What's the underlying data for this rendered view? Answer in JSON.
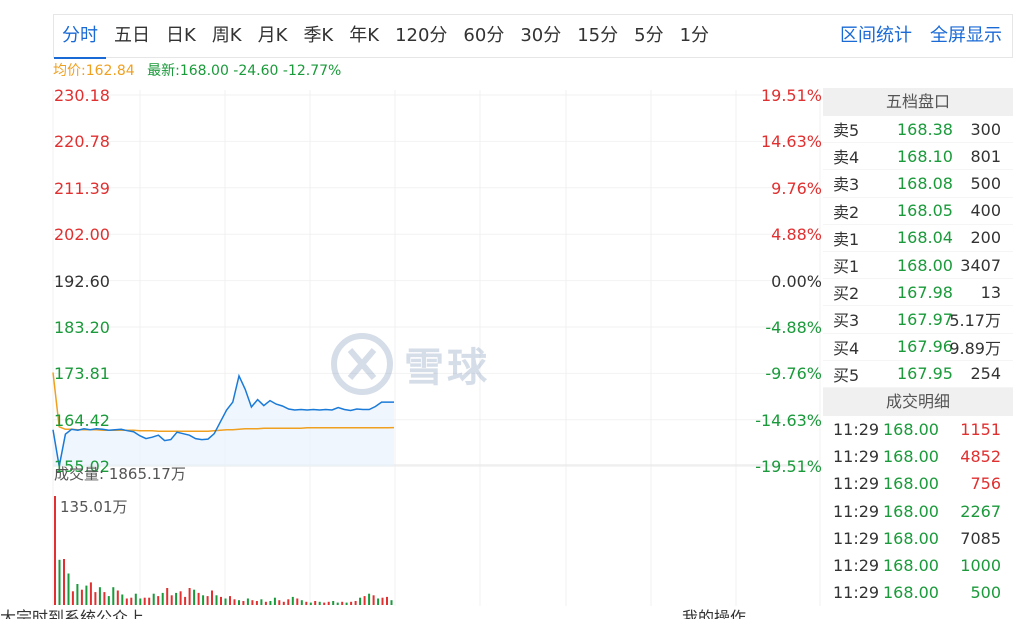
{
  "tabs": [
    "分时",
    "五日",
    "日K",
    "周K",
    "月K",
    "季K",
    "年K",
    "120分",
    "60分",
    "30分",
    "15分",
    "5分",
    "1分"
  ],
  "active_tab": "分时",
  "tabs_right": [
    "区间统计",
    "全屏显示"
  ],
  "info": {
    "avg": "均价:162.84",
    "latest": "最新:168.00 -24.60 -12.77%"
  },
  "y_left": [
    "230.18",
    "220.78",
    "211.39",
    "202.00",
    "192.60",
    "183.20",
    "173.81",
    "164.42",
    "155.02"
  ],
  "y_right": [
    "19.51%",
    "14.63%",
    "9.76%",
    "4.88%",
    "0.00%",
    "-4.88%",
    "-9.76%",
    "-14.63%",
    "-19.51%"
  ],
  "volume_label": "成交量: 1865.17万",
  "volume_max": "135.01万",
  "watermark": "雪球",
  "order_book": {
    "title": "五档盘口",
    "rows": [
      {
        "label": "卖5",
        "price": "168.38",
        "vol": "300"
      },
      {
        "label": "卖4",
        "price": "168.10",
        "vol": "801"
      },
      {
        "label": "卖3",
        "price": "168.08",
        "vol": "500"
      },
      {
        "label": "卖2",
        "price": "168.05",
        "vol": "400"
      },
      {
        "label": "卖1",
        "price": "168.04",
        "vol": "200"
      },
      {
        "label": "买1",
        "price": "168.00",
        "vol": "3407"
      },
      {
        "label": "买2",
        "price": "167.98",
        "vol": "13"
      },
      {
        "label": "买3",
        "price": "167.97",
        "vol": "5.17万"
      },
      {
        "label": "买4",
        "price": "167.96",
        "vol": "9.89万"
      },
      {
        "label": "买5",
        "price": "167.95",
        "vol": "254"
      }
    ]
  },
  "trades": {
    "title": "成交明细",
    "rows": [
      {
        "time": "11:29",
        "price": "168.00",
        "vol": "1151",
        "color": "#e03030"
      },
      {
        "time": "11:29",
        "price": "168.00",
        "vol": "4852",
        "color": "#e03030"
      },
      {
        "time": "11:29",
        "price": "168.00",
        "vol": "756",
        "color": "#e03030"
      },
      {
        "time": "11:29",
        "price": "168.00",
        "vol": "2267",
        "color": "#1a9a3a"
      },
      {
        "time": "11:29",
        "price": "168.00",
        "vol": "7085",
        "color": "#333333"
      },
      {
        "time": "11:29",
        "price": "168.00",
        "vol": "1000",
        "color": "#1a9a3a"
      },
      {
        "time": "11:29",
        "price": "168.00",
        "vol": "500",
        "color": "#1a9a3a"
      }
    ]
  },
  "chart_data": {
    "type": "line",
    "price_series": [
      162.4,
      155.0,
      161.5,
      162.5,
      162.3,
      162.6,
      162.4,
      162.6,
      162.5,
      162.3,
      162.4,
      162.5,
      162.2,
      162.0,
      161.2,
      160.6,
      160.9,
      161.3,
      160.2,
      160.4,
      161.9,
      161.6,
      161.3,
      160.6,
      160.4,
      160.5,
      161.6,
      164.0,
      166.4,
      168.0,
      173.3,
      170.6,
      167.0,
      168.5,
      167.3,
      168.3,
      167.6,
      167.2,
      166.6,
      166.4,
      166.5,
      166.4,
      166.5,
      166.4,
      166.5,
      166.4,
      166.9,
      166.5,
      166.3,
      166.6,
      166.5,
      166.5,
      167.1,
      168.0,
      168.0,
      168.0
    ],
    "avg_series": [
      174.0,
      163.0,
      162.5,
      162.5,
      162.4,
      162.4,
      162.4,
      162.4,
      162.3,
      162.3,
      162.3,
      162.3,
      162.3,
      162.3,
      162.2,
      162.2,
      162.2,
      162.1,
      162.1,
      162.1,
      162.1,
      162.1,
      162.1,
      162.1,
      162.1,
      162.1,
      162.2,
      162.3,
      162.4,
      162.4,
      162.5,
      162.6,
      162.6,
      162.6,
      162.7,
      162.7,
      162.7,
      162.7,
      162.7,
      162.7,
      162.7,
      162.8,
      162.8,
      162.8,
      162.8,
      162.8,
      162.8,
      162.8,
      162.8,
      162.8,
      162.8,
      162.8,
      162.8,
      162.8,
      162.8,
      162.84
    ],
    "volume_series": [
      135.0,
      56.0,
      57.0,
      39.0,
      17.0,
      26.0,
      19.0,
      24.0,
      28.0,
      16.0,
      22.0,
      16.0,
      11.0,
      22.0,
      18.0,
      13.0,
      8.0,
      9.0,
      14.0,
      8.0,
      9.0,
      9.0,
      14.0,
      11.0,
      15.0,
      21.0,
      12.0,
      15.0,
      17.0,
      10.0,
      21.0,
      19.0,
      15.0,
      12.0,
      11.0,
      18.0,
      12.0,
      10.0,
      8.0,
      11.0,
      7.0,
      6.0,
      5.0,
      8.0,
      6.0,
      5.0,
      7.0,
      4.0,
      5.0,
      9.0,
      6.0,
      4.0,
      7.0,
      10.0,
      8.0,
      6.0,
      4.0,
      3.0,
      5.0,
      4.0,
      3.0,
      4.0,
      5.0,
      3.0,
      4.0,
      3.0,
      4.0,
      5.0,
      9.0,
      11.0,
      14.0,
      12.0,
      8.0,
      9.0,
      10.0,
      6.0
    ],
    "volume_colors": [
      "r",
      "g",
      "r",
      "g",
      "r",
      "g",
      "r",
      "g",
      "r",
      "r",
      "g",
      "r",
      "g",
      "g",
      "r",
      "g",
      "r",
      "r",
      "g",
      "g",
      "r",
      "r",
      "g",
      "r",
      "g",
      "r",
      "r",
      "g",
      "r",
      "r",
      "r",
      "g",
      "r",
      "g",
      "r",
      "r",
      "g",
      "r",
      "g",
      "r",
      "r",
      "g",
      "r",
      "g",
      "r",
      "r",
      "g",
      "r",
      "g",
      "g",
      "r",
      "r",
      "r",
      "g",
      "r",
      "g",
      "r",
      "g",
      "r",
      "g",
      "r",
      "r",
      "g",
      "g",
      "r",
      "g",
      "r",
      "r",
      "g",
      "r",
      "g",
      "r",
      "g",
      "r",
      "r",
      "g"
    ],
    "ylim": [
      155.02,
      230.18
    ],
    "prev_close": 192.6,
    "colors": {
      "price_line": "#1a7ad8",
      "avg_line": "#f0a020",
      "up": "#e03030",
      "down": "#1a9a3a"
    }
  },
  "footer": {
    "left": "大宗时到系统公众上",
    "right": "我的操作"
  }
}
